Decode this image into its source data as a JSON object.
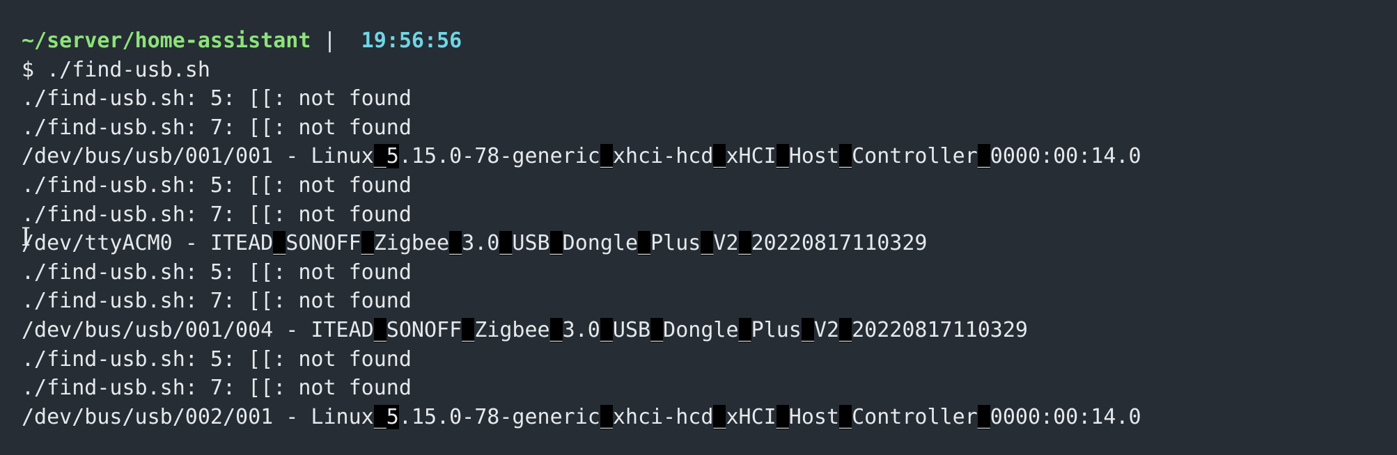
{
  "prompt": {
    "cwd": "~/server/home-assistant",
    "separator": " | ",
    "time": "19:56:56"
  },
  "command": {
    "symbol": "$",
    "text": " ./find-usb.sh"
  },
  "output": {
    "err5": "./find-usb.sh: 5: [[: not found",
    "err7": "./find-usb.sh: 7: [[: not found",
    "dev1": {
      "s1": "/dev/bus/usb/001/001 - Linux",
      "b1": "_",
      "s2": "5",
      "s3": ".15.0-78-generic",
      "b2": "_",
      "s4": "xhci-hcd",
      "b3": "_",
      "s5": "xHCI",
      "b4": "_",
      "s6": "Host",
      "b5": "_",
      "s7": "Controller",
      "b6": "_",
      "s8": "0000:00:14.0"
    },
    "dev2": {
      "s1": "/dev/ttyACM0 - ITEAD",
      "b1": "_",
      "s2": "SONOFF",
      "b2": "_",
      "s3": "Zigbee",
      "b3": "_",
      "s4": "3.0",
      "b4": "_",
      "s5": "USB",
      "b5": "_",
      "s6": "Dongle",
      "b6": "_",
      "s7": "Plus",
      "b7": "_",
      "s8": "V2",
      "b8": "_",
      "s9": "20220817110329"
    },
    "dev3": {
      "s1": "/dev/bus/usb/001/004 - ITEAD",
      "b1": "_",
      "s2": "SONOFF",
      "b2": "_",
      "s3": "Zigbee",
      "b3": "_",
      "s4": "3.0",
      "b4": "_",
      "s5": "USB",
      "b5": "_",
      "s6": "Dongle",
      "b6": "_",
      "s7": "Plus",
      "b7": "_",
      "s8": "V2",
      "b8": "_",
      "s9": "20220817110329"
    },
    "dev4": {
      "s1": "/dev/bus/usb/002/001 - Linux",
      "b1": "_",
      "s2": "5",
      "s3": ".15.0-78-generic",
      "b2": "_",
      "s4": "xhci-hcd",
      "b3": "_",
      "s5": "xHCI",
      "b4": "_",
      "s6": "Host",
      "b5": "_",
      "s7": "Controller",
      "b6": "_",
      "s8": "0000:00:14.0"
    }
  },
  "colors": {
    "background": "#262d35",
    "text": "#e6e9ec",
    "cwd": "#8de37a",
    "time": "#6fd6e6",
    "highlight": "#000000"
  },
  "icons": {
    "cursor": "text-cursor-icon"
  }
}
